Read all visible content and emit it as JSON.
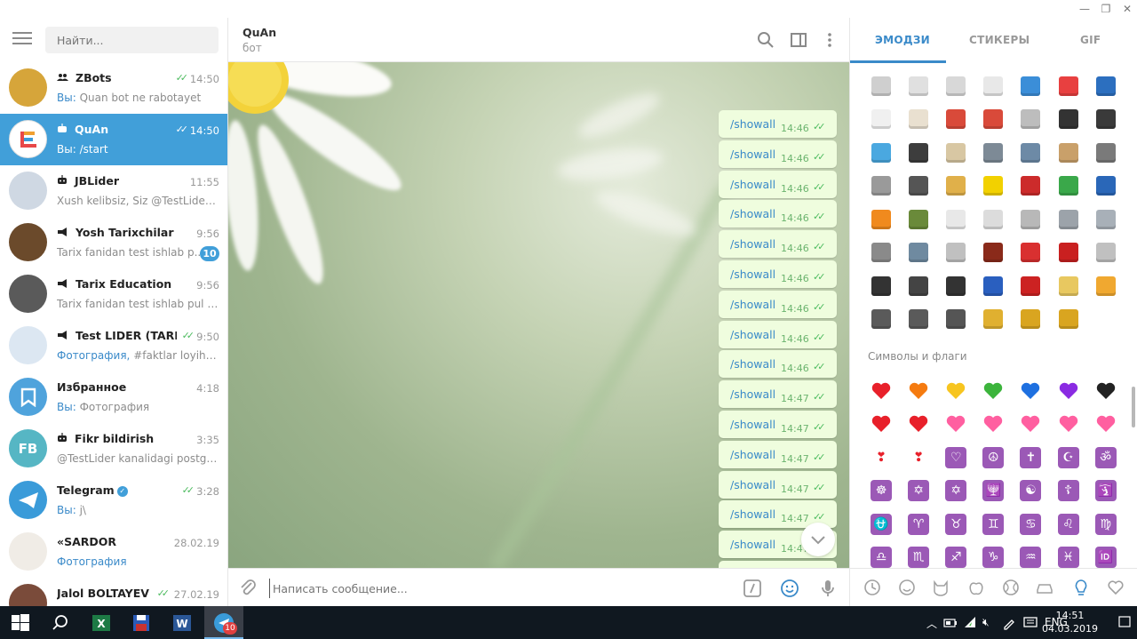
{
  "window": {
    "minimize": "—",
    "restore": "❐",
    "close": "✕"
  },
  "search": {
    "placeholder": "Найти..."
  },
  "chats": [
    {
      "name": "ZBots",
      "type": "group",
      "time": "14:50",
      "ticks": true,
      "preview_prefix": "Вы: ",
      "preview": "Quan bot ne rabotayet",
      "avatar_color": "#d6a53a"
    },
    {
      "name": "QuAn",
      "type": "bot",
      "time": "14:50",
      "ticks": true,
      "preview_prefix": "Вы: ",
      "preview": "/start",
      "avatar_color": "#ffffff",
      "active": true
    },
    {
      "name": "JBLider",
      "type": "bot",
      "time": "11:55",
      "preview_prefix": "",
      "preview": "Xush kelibsiz, Siz @TestLiderTar...",
      "avatar_color": "#cfd8e3"
    },
    {
      "name": "Yosh Tarixchilar",
      "type": "channel",
      "time": "9:56",
      "preview_prefix": "",
      "preview": "Tarix fanidan test ishlab p...",
      "badge": "10",
      "avatar_color": "#6b4a2b"
    },
    {
      "name": "Tarix Education",
      "type": "channel",
      "time": "9:56",
      "preview_prefix": "",
      "preview": "Tarix fanidan test ishlab pul yut...",
      "avatar_color": "#5a5a5a"
    },
    {
      "name": "Test LIDER (TARIX ...",
      "type": "channel",
      "time": "9:50",
      "ticks": true,
      "preview_prefix": "Фотография, ",
      "preview": "#faktlar loyihasi ...",
      "avatar_color": "#dce7f2"
    },
    {
      "name": "Избранное",
      "type": "saved",
      "time": "4:18",
      "preview_prefix": "Вы: ",
      "preview": "Фотография",
      "avatar_color": "#4fa3dc"
    },
    {
      "name": "Fikr bildirish",
      "type": "bot",
      "time": "3:35",
      "preview_prefix": "",
      "preview": "@TestLider kanalidagi postga s...",
      "avatar_text": "FB",
      "avatar_color": "#56b6c4"
    },
    {
      "name": "Telegram",
      "type": "official",
      "time": "3:28",
      "ticks": true,
      "preview_prefix": "Вы: ",
      "preview": "j\\",
      "avatar_color": "#3a9bd9"
    },
    {
      "name": "«SARDOR",
      "type": "user",
      "time": "28.02.19",
      "preview_prefix": "Фотография",
      "preview": "",
      "avatar_color": "#f0ece6"
    },
    {
      "name": "Jalol BOLTAYEV",
      "type": "user",
      "time": "27.02.19",
      "ticks": true,
      "preview_prefix": "",
      "preview": "",
      "avatar_color": "#7a4b3a"
    }
  ],
  "conversation": {
    "title": "QuAn",
    "status": "бот",
    "messages": [
      {
        "text": "/showall",
        "time": "14:46"
      },
      {
        "text": "/showall",
        "time": "14:46"
      },
      {
        "text": "/showall",
        "time": "14:46"
      },
      {
        "text": "/showall",
        "time": "14:46"
      },
      {
        "text": "/showall",
        "time": "14:46"
      },
      {
        "text": "/showall",
        "time": "14:46"
      },
      {
        "text": "/showall",
        "time": "14:46"
      },
      {
        "text": "/showall",
        "time": "14:46"
      },
      {
        "text": "/showall",
        "time": "14:46"
      },
      {
        "text": "/showall",
        "time": "14:47"
      },
      {
        "text": "/showall",
        "time": "14:47"
      },
      {
        "text": "/showall",
        "time": "14:47"
      },
      {
        "text": "/showall",
        "time": "14:47"
      },
      {
        "text": "/showall",
        "time": "14:47"
      },
      {
        "text": "/showall",
        "time": "14:47"
      },
      {
        "text": "/showall",
        "time": "14:47"
      },
      {
        "text": "/showall",
        "time": "14:47"
      }
    ],
    "composer_placeholder": "Написать сообщение..."
  },
  "emoji_panel": {
    "tabs": [
      "ЭМОДЗИ",
      "СТИКЕРЫ",
      "GIF"
    ],
    "section_symbols": "Символы и флаги",
    "objects_rows": [
      [
        "#cfcfcf",
        "#e0e0e0",
        "#d8d8d8",
        "#e8e8e8",
        "#3b8ed8",
        "#e84040",
        "#2c6fbf"
      ],
      [
        "#f0f0f0",
        "#e9e0d0",
        "#d94a3a",
        "#d94a3a",
        "#bdbdbd",
        "#333333",
        "#3a3a3a"
      ],
      [
        "#4aa8e0",
        "#3d3d3d",
        "#d8c7a3",
        "#7d8a96",
        "#6d8aa6",
        "#c9a06a",
        "#7a7a7a"
      ],
      [
        "#9a9a9a",
        "#555555",
        "#e0b04a",
        "#f2d100",
        "#cc2b2b",
        "#3aa84a",
        "#2a67b8"
      ],
      [
        "#f08a1e",
        "#6a8a3a",
        "#e8e8e8",
        "#dcdcdc",
        "#b8b8b8",
        "#9ca3aa",
        "#a8b0b8"
      ],
      [
        "#8a8a8a",
        "#6f8aa0",
        "#c0c0c0",
        "#8a2a1a",
        "#d93030",
        "#c92020",
        "#c0c0c0"
      ],
      [
        "#333333",
        "#444444",
        "#333333",
        "#2a5fbf",
        "#cc2222",
        "#e8c860",
        "#f0a830"
      ],
      [
        "#5a5a5a",
        "#5a5a5a",
        "#555555",
        "#e0b030",
        "#d9a520",
        "#d9a520"
      ]
    ],
    "hearts": [
      "#e8202a",
      "#f57b10",
      "#f7c520",
      "#3cb43c",
      "#1e70e0",
      "#8a2be2",
      "#222222"
    ],
    "heart_row2": [
      "#e8202a",
      "#e8202a",
      "#ff5fa0",
      "#ff5fa0",
      "#ff5fa0",
      "#ff5fa0",
      "#ff5fa0"
    ],
    "symbol_row1": [
      "❣",
      "❣",
      "♡",
      "☮",
      "✝",
      "☪",
      "ॐ"
    ],
    "symbol_row2": [
      "☸",
      "✡",
      "✡",
      "🕎",
      "☯",
      "☦",
      "🛐"
    ],
    "symbol_row3": [
      "⛎",
      "♈",
      "♉",
      "♊",
      "♋",
      "♌",
      "♍"
    ],
    "symbol_row4": [
      "♎",
      "♏",
      "♐",
      "♑",
      "♒",
      "♓",
      "🆔"
    ]
  },
  "taskbar": {
    "lang": "ENG",
    "time": "14:51",
    "date": "04.03.2019",
    "telegram_badge": "10"
  }
}
